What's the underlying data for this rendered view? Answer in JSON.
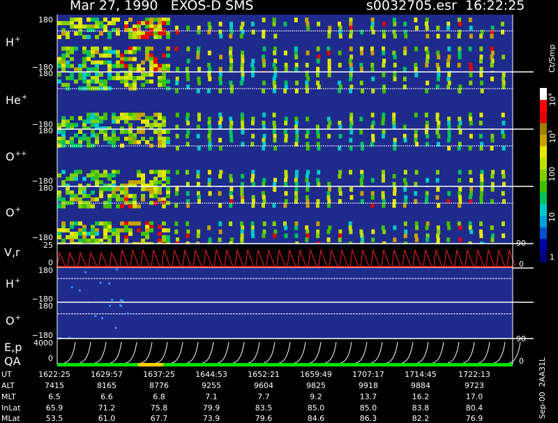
{
  "header": {
    "title": "Mar 27, 1990   EXOS-D SMS",
    "file_time": "s0032705.esr  16:22:25"
  },
  "panel_labels": {
    "H": "H",
    "He": "He",
    "O2": "O",
    "O": "O",
    "V": "V,r",
    "H2": "H",
    "O3": "O",
    "E": "E,p",
    "QA": "QA"
  },
  "panel_label_sups": {
    "plus": "+",
    "plusplus": "++"
  },
  "ticks": {
    "p180": "180",
    "m180": "−180",
    "v25": "25",
    "v0": "0",
    "e4000": "4000",
    "e0": "0",
    "r90": "90",
    "r0": "0"
  },
  "colorbar": {
    "title": "Ct/Smp",
    "labels": [
      "1",
      "10",
      "100",
      "10",
      "10"
    ],
    "exponents": [
      "3",
      "4"
    ],
    "colors": [
      "#000080",
      "#0000a8",
      "#0050d0",
      "#00a0e0",
      "#00c8c8",
      "#00c060",
      "#40c000",
      "#80d000",
      "#c0e000",
      "#e8e800",
      "#c8a000",
      "#a08000",
      "#e00000",
      "#ff0000",
      "#ffffff"
    ]
  },
  "footer": {
    "version": "Sep-00  2AA31L",
    "rows": [
      {
        "label": "UT",
        "values": [
          "1622:25",
          "1629:57",
          "1637:25",
          "1644:53",
          "1652:21",
          "1659:49",
          "1707:17",
          "1714:45",
          "1722:13"
        ]
      },
      {
        "label": "ALT",
        "values": [
          "7415",
          "8165",
          "8776",
          "9255",
          "9604",
          "9825",
          "9918",
          "9884",
          "9723"
        ]
      },
      {
        "label": "MLT",
        "values": [
          "6.5",
          "6.6",
          "6.8",
          "7.1",
          "7.7",
          "9.2",
          "13.7",
          "16.2",
          "17.0"
        ]
      },
      {
        "label": "InLat",
        "values": [
          "65.9",
          "71.2",
          "75.8",
          "79.9",
          "83.5",
          "85.0",
          "85.0",
          "83.8",
          "80.4"
        ]
      },
      {
        "label": "MLat",
        "values": [
          "53.5",
          "61.0",
          "67.7",
          "73.9",
          "79.6",
          "84.6",
          "86.3",
          "82.2",
          "76.9"
        ]
      }
    ]
  },
  "chart_data": {
    "type": "heatmap",
    "title": "Mar 27, 1990   EXOS-D SMS",
    "x_ticks": [
      "1622:25",
      "1629:57",
      "1637:25",
      "1644:53",
      "1652:21",
      "1659:49",
      "1707:17",
      "1714:45",
      "1722:13"
    ],
    "panels": [
      {
        "name": "H+",
        "ylim": [
          -180,
          180
        ]
      },
      {
        "name": "He+",
        "ylim": [
          -180,
          180
        ]
      },
      {
        "name": "O++",
        "ylim": [
          -180,
          180
        ]
      },
      {
        "name": "O+",
        "ylim": [
          -180,
          180
        ]
      },
      {
        "name": "V,r",
        "ylim": [
          0,
          25
        ],
        "right_ylim": [
          0,
          90
        ]
      },
      {
        "name": "H+",
        "ylim": [
          -180,
          180
        ]
      },
      {
        "name": "O+",
        "ylim": [
          -180,
          180
        ]
      },
      {
        "name": "E,p",
        "ylim": [
          0,
          4000
        ],
        "right_ylim": [
          0,
          90
        ]
      },
      {
        "name": "QA"
      }
    ],
    "colorbar": {
      "label": "Ct/Smp",
      "scale": "log",
      "range": [
        1,
        10000
      ]
    }
  }
}
